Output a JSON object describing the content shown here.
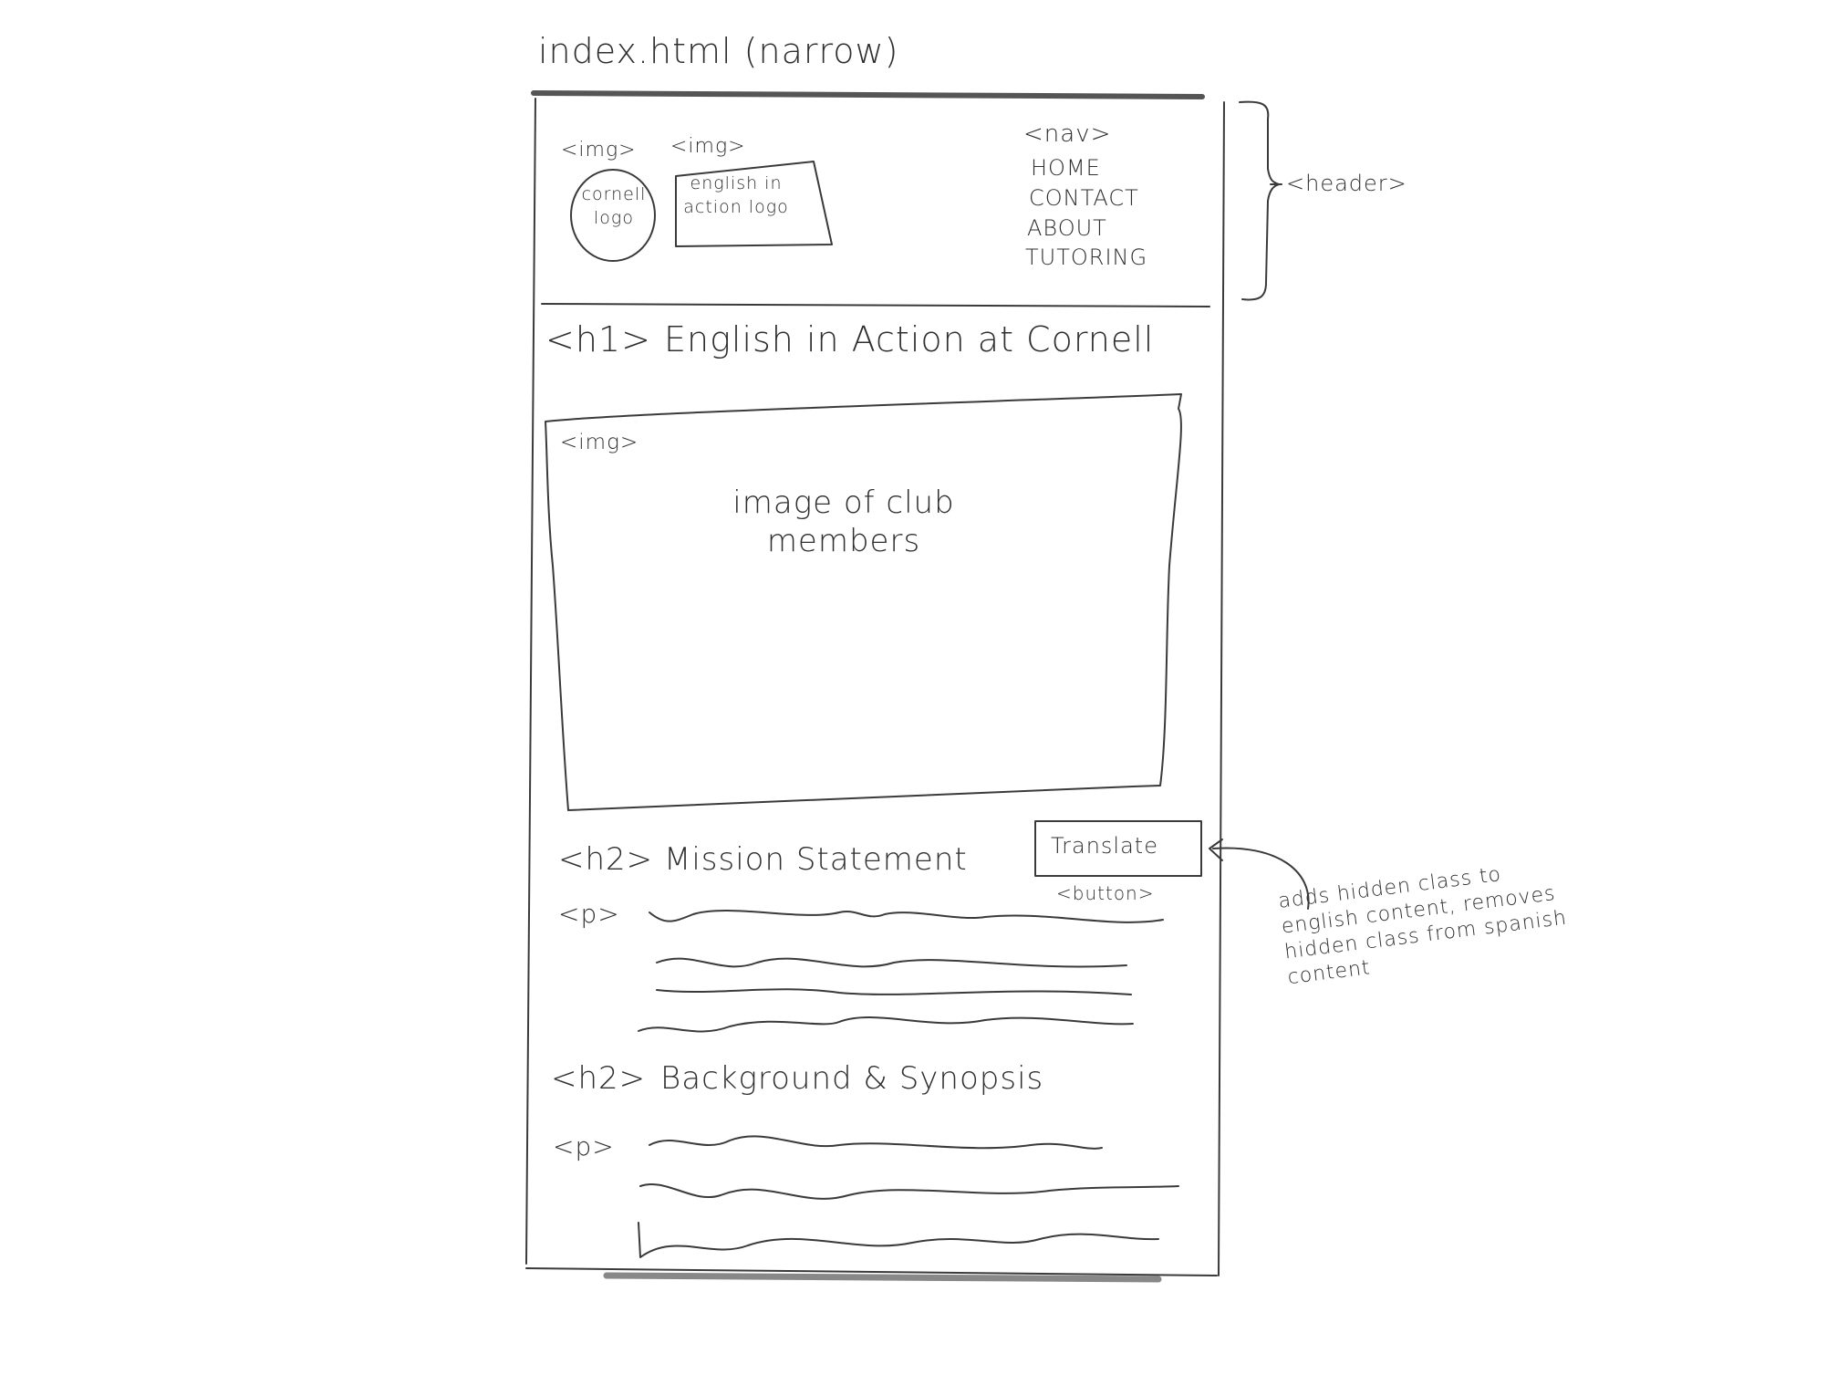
{
  "page_title": "index.html (narrow)",
  "header": {
    "cornell_logo": {
      "tag": "<img>",
      "text": "cornell logo"
    },
    "eia_logo": {
      "tag": "<img>",
      "text": "english in action logo"
    },
    "nav": {
      "tag": "<nav>",
      "items": [
        "HOME",
        "CONTACT",
        "ABOUT",
        "TUTORING"
      ]
    },
    "bracket_label": "<header>"
  },
  "h1": {
    "tag": "<h1>",
    "text": "English in Action at Cornell"
  },
  "hero_image": {
    "tag": "<img>",
    "text": "image of club members"
  },
  "mission": {
    "tag": "<h2>",
    "title": "Mission Statement",
    "p_tag": "<p>"
  },
  "translate_button": {
    "label": "Translate",
    "tag": "<button>"
  },
  "annotation": "adds hidden class to english content, removes hidden class from spanish content",
  "background": {
    "tag": "<h2>",
    "title": "Background & Synopsis",
    "p_tag": "<p>"
  }
}
